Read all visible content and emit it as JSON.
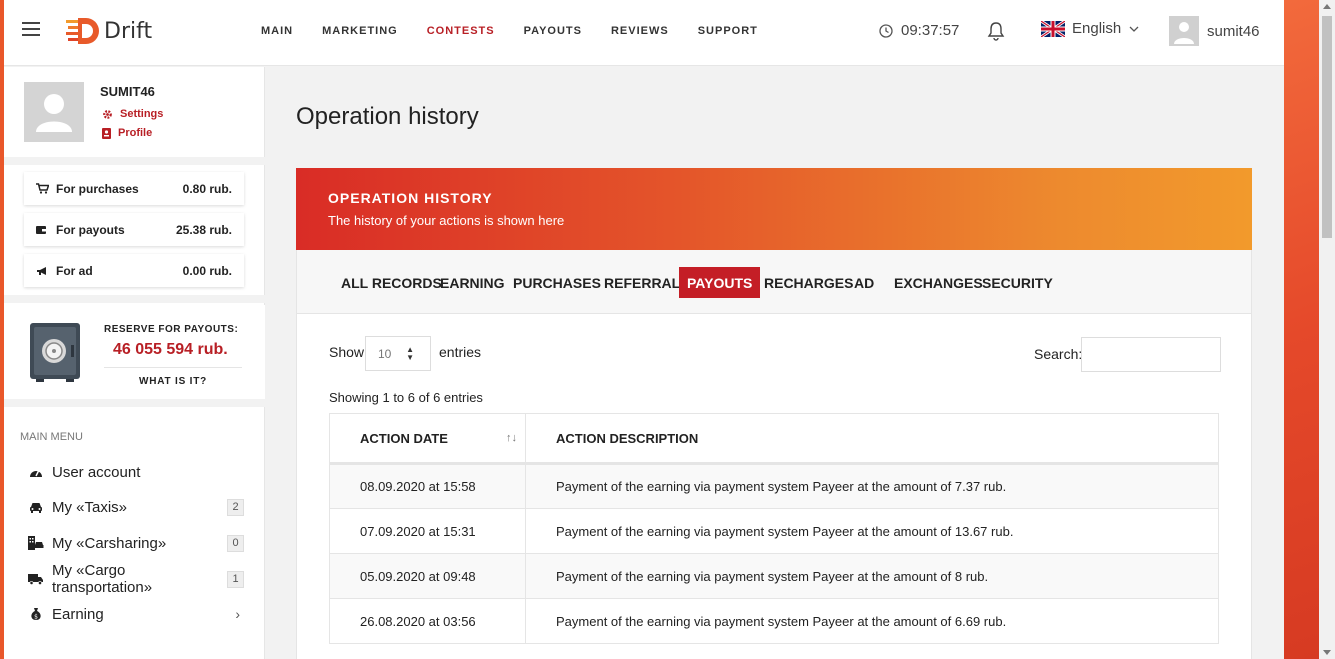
{
  "app": {
    "logo_text": "Drift"
  },
  "nav": [
    {
      "label": "MAIN",
      "active": false
    },
    {
      "label": "MARKETING",
      "active": false
    },
    {
      "label": "CONTESTS",
      "active": true
    },
    {
      "label": "PAYOUTS",
      "active": false
    },
    {
      "label": "REVIEWS",
      "active": false
    },
    {
      "label": "SUPPORT",
      "active": false
    }
  ],
  "header": {
    "time": "09:37:57",
    "language": "English",
    "username": "sumit46"
  },
  "profile": {
    "name": "SUMIT46",
    "settings_label": "Settings",
    "profile_label": "Profile"
  },
  "balances": [
    {
      "label": "For purchases",
      "value": "0.80 rub.",
      "icon": "cart-icon"
    },
    {
      "label": "For payouts",
      "value": "25.38 rub.",
      "icon": "wallet-icon"
    },
    {
      "label": "For ad",
      "value": "0.00 rub.",
      "icon": "megaphone-icon"
    }
  ],
  "reserve": {
    "label": "RESERVE FOR PAYOUTS:",
    "value": "46 055 594 rub.",
    "what_label": "WHAT IS IT?"
  },
  "menu": {
    "title": "MAIN MENU",
    "items": [
      {
        "label": "User account",
        "icon": "dashboard-icon",
        "count": null
      },
      {
        "label": "My «Taxis»",
        "icon": "car-icon",
        "count": "2"
      },
      {
        "label": "My «Carsharing»",
        "icon": "car-building-icon",
        "count": "0"
      },
      {
        "label": "My «Cargo transportation»",
        "icon": "truck-icon",
        "count": "1"
      },
      {
        "label": "Earning",
        "icon": "money-bag-icon",
        "count": null
      }
    ]
  },
  "content": {
    "page_title": "Operation history",
    "card_title": "OPERATION HISTORY",
    "card_subtitle": "The history of your actions is shown here",
    "tabs": [
      {
        "label": "ALL RECORDS",
        "active": false
      },
      {
        "label": "EARNING",
        "active": false
      },
      {
        "label": "PURCHASES",
        "active": false
      },
      {
        "label": "REFERRALS",
        "active": false
      },
      {
        "label": "PAYOUTS",
        "active": true
      },
      {
        "label": "RECHARGES",
        "active": false
      },
      {
        "label": "AD",
        "active": false
      },
      {
        "label": "EXCHANGES",
        "active": false
      },
      {
        "label": "SECURITY",
        "active": false
      }
    ],
    "show_label": "Show",
    "entries_value": "10",
    "entries_label": "entries",
    "search_label": "Search:",
    "search_value": "",
    "info": "Showing 1 to 6 of 6 entries",
    "table": {
      "columns": [
        "ACTION DATE",
        "ACTION DESCRIPTION"
      ],
      "rows": [
        [
          "08.09.2020 at 15:58",
          "Payment of the earning via payment system Payeer at the amount of 7.37 rub."
        ],
        [
          "07.09.2020 at 15:31",
          "Payment of the earning via payment system Payeer at the amount of 13.67 rub."
        ],
        [
          "05.09.2020 at 09:48",
          "Payment of the earning via payment system Payeer at the amount of 8 rub."
        ],
        [
          "26.08.2020 at 03:56",
          "Payment of the earning via payment system Payeer at the amount of 6.69 rub."
        ]
      ]
    }
  },
  "colors": {
    "accent": "#b81f25",
    "tab_active": "#c41e26",
    "gradient_start": "#d92c26",
    "gradient_end": "#f29a2c"
  }
}
